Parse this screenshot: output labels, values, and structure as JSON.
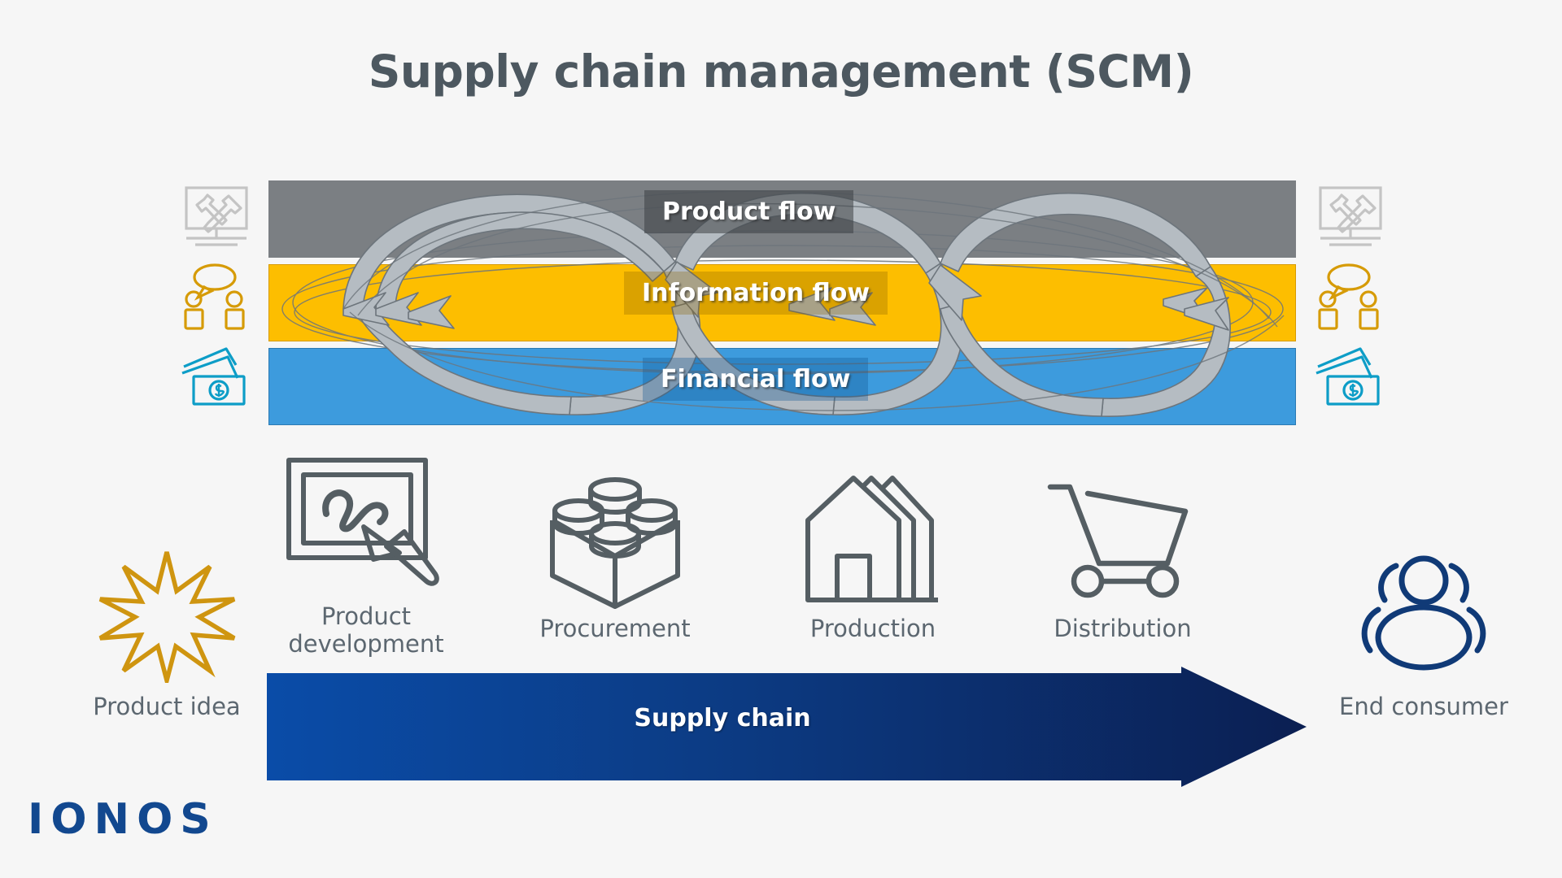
{
  "title": "Supply chain management (SCM)",
  "flows": {
    "bands": [
      {
        "key": "product",
        "label": "Product flow",
        "color": "#7b7f83"
      },
      {
        "key": "information",
        "label": "Information flow",
        "color": "#fdbe00"
      },
      {
        "key": "financial",
        "label": "Financial flow",
        "color": "#3d9bdd"
      }
    ],
    "side_icons": [
      {
        "name": "monitor-tools-icon",
        "color": "#c4c4c4"
      },
      {
        "name": "people-speech-icon",
        "color": "#d69b07"
      },
      {
        "name": "banknotes-dollar-icon",
        "color": "#0d9dc7"
      }
    ]
  },
  "stages": [
    {
      "label": "Product idea",
      "icon": "starburst-icon",
      "color": "#cf9510"
    },
    {
      "label": "Product development",
      "icon": "design-board-pen-icon",
      "color": "#555e63"
    },
    {
      "label": "Procurement",
      "icon": "building-block-icon",
      "color": "#555e63"
    },
    {
      "label": "Production",
      "icon": "factory-house-icon",
      "color": "#555e63"
    },
    {
      "label": "Distribution",
      "icon": "shopping-cart-icon",
      "color": "#555e63"
    },
    {
      "label": "End consumer",
      "icon": "group-people-icon",
      "color": "#103a77"
    }
  ],
  "supply_chain": {
    "label": "Supply chain",
    "gradient_from": "#0a4ca8",
    "gradient_to": "#0b1f52"
  },
  "brand": {
    "logo_text": "IONOS",
    "color": "#12488f"
  },
  "colors": {
    "background": "#f6f6f6",
    "title": "#4d5860",
    "stage_text": "#5c6770",
    "arrow_gray_fill": "#b5bcc2",
    "arrow_gray_stroke": "#6d757c"
  }
}
